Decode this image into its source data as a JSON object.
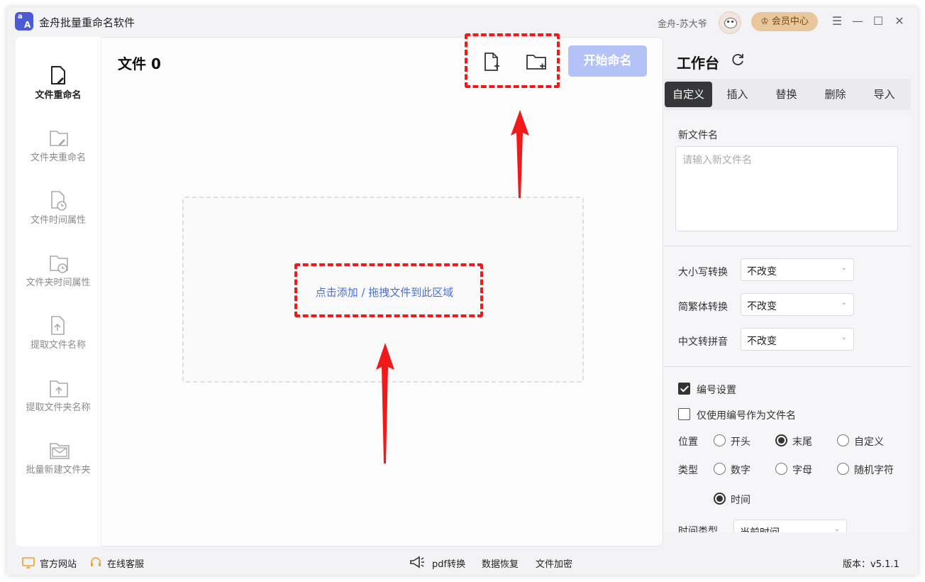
{
  "app": {
    "title": "金舟批量重命名软件",
    "user": "金舟-苏大爷",
    "vip_label": "会员中心"
  },
  "sidebar": {
    "items": [
      {
        "label": "文件重命名",
        "icon": "file-edit-icon",
        "active": true
      },
      {
        "label": "文件夹重命名",
        "icon": "folder-edit-icon"
      },
      {
        "label": "文件时间属性",
        "icon": "file-clock-icon"
      },
      {
        "label": "文件夹时间属性",
        "icon": "folder-clock-icon"
      },
      {
        "label": "提取文件名称",
        "icon": "file-upload-icon"
      },
      {
        "label": "提取文件夹名称",
        "icon": "folder-upload-icon"
      },
      {
        "label": "批量新建文件夹",
        "icon": "folder-mail-icon"
      }
    ]
  },
  "main": {
    "file_count": "文件 0",
    "start_label": "开始命名",
    "drop_text": "点击添加 / 拖拽文件到此区域"
  },
  "workbench": {
    "title": "工作台",
    "tabs": [
      "自定义",
      "插入",
      "替换",
      "删除",
      "导入"
    ],
    "new_name_label": "新文件名",
    "new_name_placeholder": "请输入新文件名",
    "case_label": "大小写转换",
    "case_value": "不改变",
    "trad_label": "简繁体转换",
    "trad_value": "不改变",
    "pinyin_label": "中文转拼音",
    "pinyin_value": "不改变",
    "numbering_label": "编号设置",
    "only_number_label": "仅使用编号作为文件名",
    "position_label": "位置",
    "position_options": [
      "开头",
      "末尾",
      "自定义"
    ],
    "position_selected": "末尾",
    "type_label": "类型",
    "type_options": [
      "数字",
      "字母",
      "随机字符",
      "时间"
    ],
    "type_selected": "时间",
    "time_type_label": "时间类型",
    "time_type_value": "当前时间"
  },
  "footer": {
    "website": "官方网站",
    "service": "在线客服",
    "pdf": "pdf转换",
    "recover": "数据恢复",
    "encrypt": "文件加密",
    "version": "版本：v5.1.1"
  },
  "colors": {
    "accent": "#4a6edb",
    "start_disabled": "#b3c2f7",
    "annotation": "#f01a1a",
    "tab_active": "#363739"
  }
}
